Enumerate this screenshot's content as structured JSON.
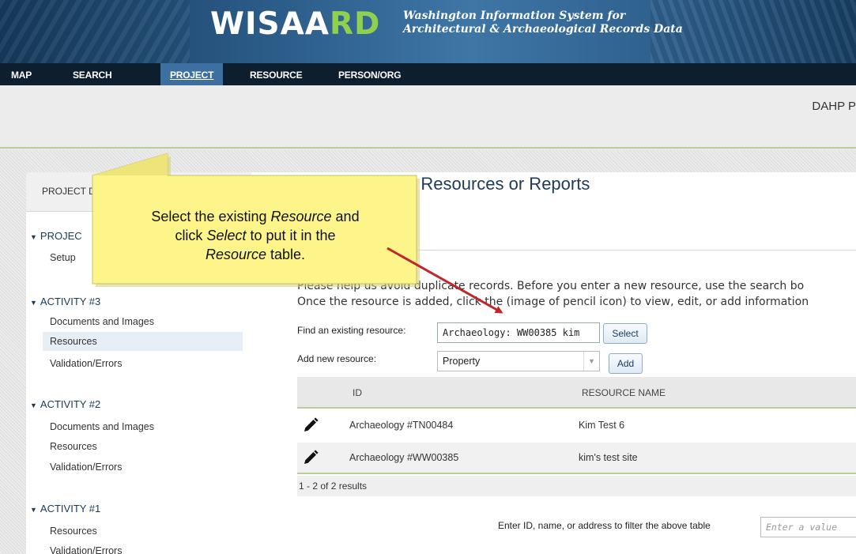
{
  "header": {
    "logo_main": "WISAA",
    "logo_rd": "RD",
    "tagline_line1": "Washington Information System for",
    "tagline_line2": "Architectural & Archaeological Records Data"
  },
  "nav": {
    "items": [
      "MAP",
      "SEARCH",
      "PROJECT",
      "RESOURCE",
      "PERSON/ORG"
    ],
    "active": "PROJECT"
  },
  "subheader": {
    "title": "DAHP P"
  },
  "sidebar": {
    "head": "PROJECT D",
    "sections": [
      {
        "title": "PROJEC",
        "links": [
          "Setup"
        ]
      },
      {
        "title": "ACTIVITY #3",
        "links": [
          "Documents and Images",
          "Resources",
          "Validation/Errors"
        ],
        "selected": "Resources"
      },
      {
        "title": "ACTIVITY #2",
        "links": [
          "Documents and Images",
          "Resources",
          "Validation/Errors"
        ]
      },
      {
        "title": "ACTIVITY #1",
        "links": [
          "Resources",
          "Validation/Errors"
        ]
      }
    ]
  },
  "content": {
    "title": "d/Edit Resources or Reports",
    "help_line1": "Please help us avoid duplicate records. Before you enter a new resource, use the search bo",
    "help_line2": "Once the resource is added, click the (image of pencil icon) to view, edit, or add information",
    "find_label": "Find an existing resource:",
    "find_value": "Archaeology: WW00385 kim",
    "select_button": "Select",
    "add_label": "Add new resource:",
    "add_select_value": "Property",
    "add_button": "Add"
  },
  "table": {
    "columns": [
      "ID",
      "RESOURCE NAME"
    ],
    "rows": [
      {
        "id": "Archaeology #TN00484",
        "name": "Kim Test 6"
      },
      {
        "id": "Archaeology #WW00385",
        "name": "kim's test site"
      }
    ],
    "count_text": "1 - 2 of 2 results",
    "filter_label": "Enter ID, name, or address to filter the above table",
    "filter_placeholder": "Enter a value"
  },
  "callout": {
    "line1_a": "Select the existing ",
    "line1_em": "Resource",
    "line1_b": " and",
    "line2_a": "click ",
    "line2_em": "Select",
    "line2_b": " to put it in the",
    "line3_em": "Resource",
    "line3_b": " table.",
    "fill": "#fdf58a",
    "arrow_color": "#c0272d"
  },
  "colors": {
    "nav_bg": "#0d1e2f",
    "nav_active": "#3d6fa0",
    "accent_green": "#b9cf9a",
    "heading_blue": "#1f3a55"
  }
}
